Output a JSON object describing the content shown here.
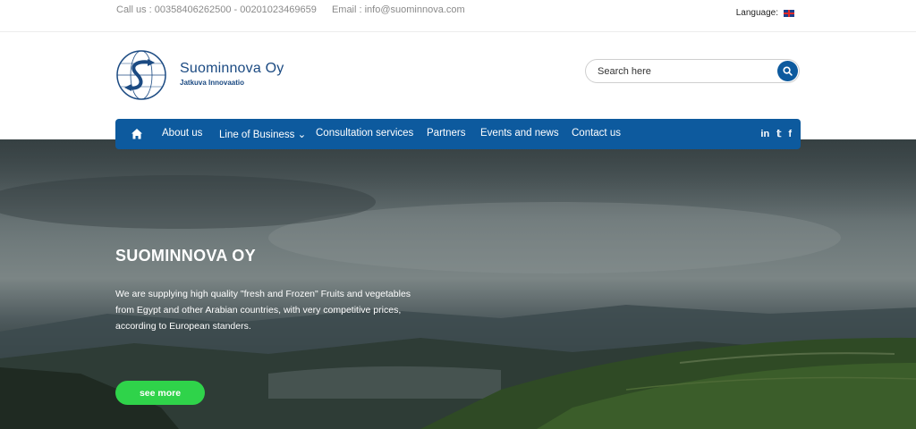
{
  "topbar": {
    "phone": "Call us : 00358406262500 - 00201023469659",
    "email": "Email : info@suominnova.com",
    "language_label": "Language:"
  },
  "header": {
    "brand_name": "Suominnova Oy",
    "brand_tagline": "Jatkuva Innovaatio",
    "search_placeholder": "Search here"
  },
  "nav": {
    "items": [
      {
        "label": "About us"
      },
      {
        "label": "Line of Business ⌄"
      },
      {
        "label": "Consultation services"
      },
      {
        "label": "Partners"
      },
      {
        "label": "Events and news"
      },
      {
        "label": "Contact us"
      }
    ],
    "social": [
      "in",
      "𝕥",
      "f"
    ]
  },
  "hero": {
    "title": "SUOMINNOVA OY",
    "text": "We are supplying high quality \"fresh and Frozen\" Fruits and vegetables from Egypt and other Arabian countries, with very competitive prices, according to European standers.",
    "button_label": "see more"
  },
  "colors": {
    "brand_blue": "#0d5a9e",
    "cta_green": "#2fd34a"
  },
  "icons": [
    "home-icon",
    "search-icon",
    "linkedin-icon",
    "twitter-icon",
    "facebook-icon",
    "chevron-down-icon",
    "uk-flag-icon"
  ]
}
